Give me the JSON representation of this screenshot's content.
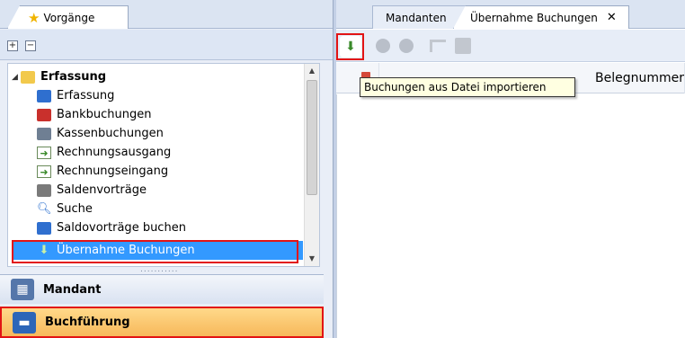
{
  "left_panel": {
    "tab_label": "Vorgänge",
    "toolbar": {
      "expand_label": "+",
      "collapse_label": "−"
    },
    "tree": {
      "root_label": "Erfassung",
      "items": [
        {
          "label": "Erfassung",
          "icon": "book-icon"
        },
        {
          "label": "Bankbuchungen",
          "icon": "bank-icon"
        },
        {
          "label": "Kassenbuchungen",
          "icon": "cash-register-icon"
        },
        {
          "label": "Rechnungsausgang",
          "icon": "invoice-out-icon"
        },
        {
          "label": "Rechnungseingang",
          "icon": "invoice-in-icon"
        },
        {
          "label": "Saldenvorträge",
          "icon": "balance-icon"
        },
        {
          "label": "Suche",
          "icon": "search-icon"
        },
        {
          "label": "Saldovorträge buchen",
          "icon": "book-icon"
        },
        {
          "label": "Übernahme Buchungen",
          "icon": "import-icon",
          "selected": true
        }
      ]
    },
    "grip": "...........",
    "nav": [
      {
        "label": "Mandant",
        "icon": "building-icon"
      },
      {
        "label": "Buchführung",
        "icon": "ledger-icon",
        "active": true
      }
    ]
  },
  "right_panel": {
    "tabs": [
      {
        "label": "Mandanten"
      },
      {
        "label": "Übernahme Buchungen",
        "close": "✕",
        "active": true
      }
    ],
    "toolbar": {
      "import_icon": "import-file-icon",
      "tooltip": "Buchungen aus Datei importieren"
    },
    "grid": {
      "columns": [
        "Belegnummer"
      ]
    }
  },
  "colors": {
    "highlight_frame": "#e21414",
    "selection": "#3399ff",
    "active_nav": "#f7b85a"
  }
}
